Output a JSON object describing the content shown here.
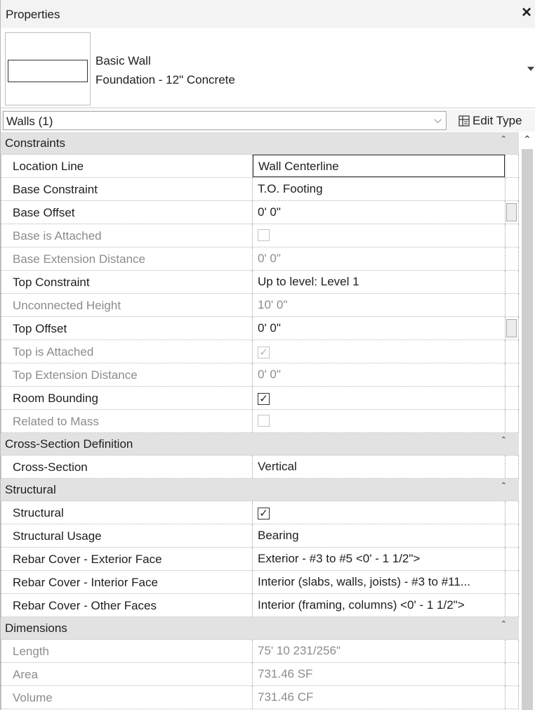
{
  "title": "Properties",
  "close_icon": "×",
  "type_selector": {
    "family": "Basic Wall",
    "type": "Foundation - 12\" Concrete",
    "dropdown_icon": "triangle-down-icon"
  },
  "filter": {
    "label": "Walls (1)",
    "chevron": "⌵",
    "edit_type_label": "Edit Type"
  },
  "sections": {
    "constraints": {
      "header": "Constraints",
      "rows": {
        "location_line": {
          "name": "Location Line",
          "value": "Wall Centerline"
        },
        "base_constraint": {
          "name": "Base Constraint",
          "value": "T.O. Footing"
        },
        "base_offset": {
          "name": "Base Offset",
          "value": "0'  0\""
        },
        "base_attached": {
          "name": "Base is Attached",
          "checked": false
        },
        "base_ext": {
          "name": "Base Extension Distance",
          "value": "0'  0\""
        },
        "top_constraint": {
          "name": "Top Constraint",
          "value": "Up to level: Level 1"
        },
        "unconnected": {
          "name": "Unconnected Height",
          "value": "10'  0\""
        },
        "top_offset": {
          "name": "Top Offset",
          "value": "0'  0\""
        },
        "top_attached": {
          "name": "Top is Attached",
          "checked": true
        },
        "top_ext": {
          "name": "Top Extension Distance",
          "value": "0'  0\""
        },
        "room_bounding": {
          "name": "Room Bounding",
          "checked": true
        },
        "related_mass": {
          "name": "Related to Mass",
          "checked": false
        }
      }
    },
    "cross_section": {
      "header": "Cross-Section Definition",
      "rows": {
        "cross_section": {
          "name": "Cross-Section",
          "value": "Vertical"
        }
      }
    },
    "structural": {
      "header": "Structural",
      "rows": {
        "structural": {
          "name": "Structural",
          "checked": true
        },
        "usage": {
          "name": "Structural Usage",
          "value": "Bearing"
        },
        "rebar_ext": {
          "name": "Rebar Cover - Exterior Face",
          "value": "Exterior - #3 to #5 <0' - 1 1/2\">"
        },
        "rebar_int": {
          "name": "Rebar Cover - Interior Face",
          "value": "Interior (slabs, walls, joists) - #3 to #11..."
        },
        "rebar_other": {
          "name": "Rebar Cover - Other Faces",
          "value": "Interior (framing, columns) <0' - 1 1/2\">"
        }
      }
    },
    "dimensions": {
      "header": "Dimensions",
      "rows": {
        "length": {
          "name": "Length",
          "value": "75'  10 231/256\""
        },
        "area": {
          "name": "Area",
          "value": "731.46 SF"
        },
        "volume": {
          "name": "Volume",
          "value": "731.46 CF"
        }
      }
    }
  },
  "check_mark": "✓",
  "collapse_icon": "⌃",
  "scroll_up_icon": "⌃"
}
